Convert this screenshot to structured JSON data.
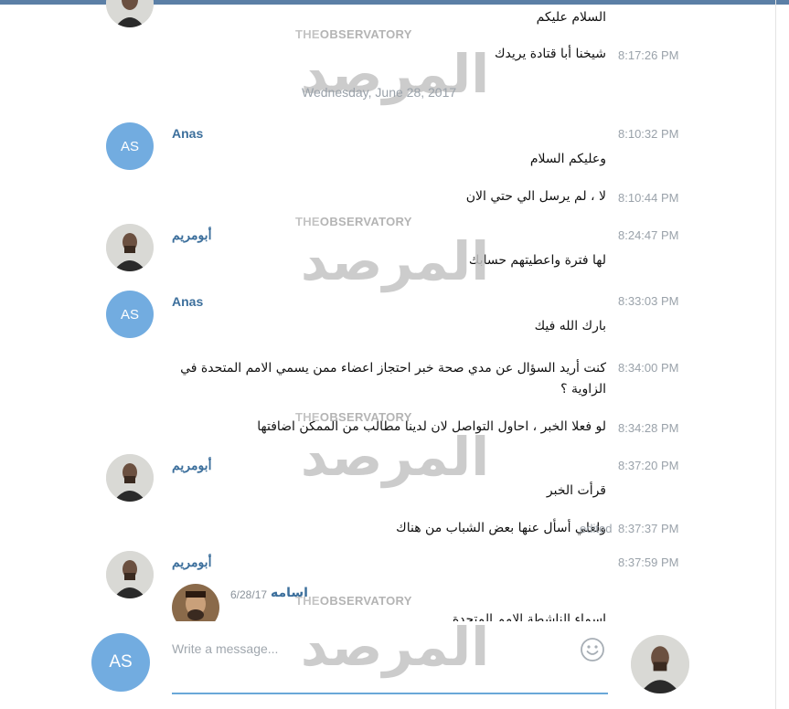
{
  "date_separator": "Wednesday, June 28, 2017",
  "watermark": {
    "top_left": "THE",
    "top_right": "OBSERVATORY",
    "mark": "المرصد"
  },
  "messages": [
    {
      "text": "السلام عليكم",
      "time": ""
    },
    {
      "text": "شيخنا أبا قتادة يريدك",
      "time": "8:17:26 PM"
    },
    {
      "sender": "Anas",
      "initials": "AS",
      "time": "8:10:32 PM"
    },
    {
      "text": "وعليكم السلام",
      "time": ""
    },
    {
      "text": "لا ، لم يرسل الي حتي الان",
      "time": "8:10:44 PM"
    },
    {
      "sender": "أبومريم",
      "time": "8:24:47 PM"
    },
    {
      "text": "لها فترة واعطيتهم حسابك",
      "time": ""
    },
    {
      "sender": "Anas",
      "initials": "AS",
      "time": "8:33:03 PM"
    },
    {
      "text": "بارك الله فيك",
      "time": ""
    },
    {
      "text": "كنت أريد السؤال عن مدي صحة خبر احتجاز اعضاء ممن يسمي الامم المتحدة في الزاوية ؟",
      "time": "8:34:00 PM"
    },
    {
      "text": "لو فعلا الخبر ، احاول التواصل لان لدينا مطالب من الممكن اضافتها",
      "time": "8:34:28 PM"
    },
    {
      "sender": "أبومريم",
      "time": "8:37:20 PM"
    },
    {
      "text": "قرأت الخبر",
      "time": ""
    },
    {
      "text": "ولعلي أسأل عنها بعض الشباب من هناك",
      "time": "8:37:37 PM",
      "edited": "edited"
    },
    {
      "sender": "أبومريم",
      "time": "8:37:59 PM"
    }
  ],
  "forwarded": {
    "name": "اسامه",
    "date": "6/28/17",
    "text": "اسماء الناشطة الامم المتحدة"
  },
  "composer": {
    "placeholder": "Write a message...",
    "avatar_initials": "AS",
    "emoji_icon": "emoji-smile-icon"
  },
  "colors": {
    "accent": "#72ace0",
    "sender_name": "#3c6f9c",
    "timestamp": "#9aa2aa",
    "top_strip": "#5b7fa6"
  }
}
